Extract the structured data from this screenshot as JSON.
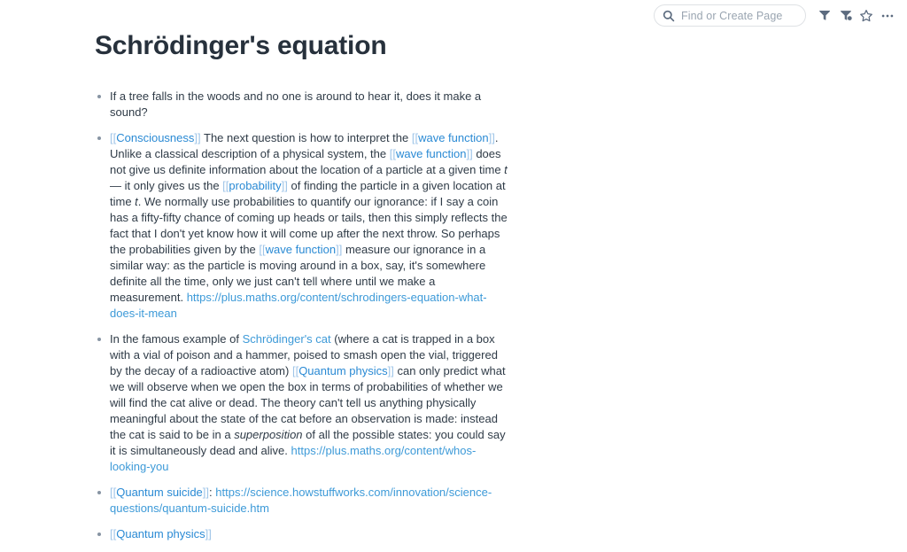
{
  "topbar": {
    "search": {
      "placeholder": "Find or Create Page",
      "value": "",
      "icon": "search-icon"
    },
    "icons": [
      {
        "name": "filter-icon",
        "label": "Filter"
      },
      {
        "name": "linked-references-icon",
        "label": "Linked References"
      },
      {
        "name": "star-icon",
        "label": "Favorite"
      },
      {
        "name": "more-options-icon",
        "label": "More"
      }
    ]
  },
  "page": {
    "title": "Schrödinger's equation",
    "bullets": [
      {
        "id": "bullet-tree-falls",
        "tokens": [
          {
            "t": "text",
            "v": "If a tree falls in the woods and no one is around to hear it, does it make a sound?"
          }
        ]
      },
      {
        "id": "bullet-consciousness",
        "tokens": [
          {
            "t": "brk",
            "v": "[["
          },
          {
            "t": "wikilink",
            "v": "Consciousness"
          },
          {
            "t": "brk",
            "v": "]]"
          },
          {
            "t": "text",
            "v": " The next question is how to interpret the "
          },
          {
            "t": "brk",
            "v": "[["
          },
          {
            "t": "wikilink",
            "v": "wave function"
          },
          {
            "t": "brk",
            "v": "]]"
          },
          {
            "t": "text",
            "v": ". Unlike a classical description of a physical system, the "
          },
          {
            "t": "brk",
            "v": "[["
          },
          {
            "t": "wikilink",
            "v": "wave function"
          },
          {
            "t": "brk",
            "v": "]]"
          },
          {
            "t": "text",
            "v": " does not give us definite information about the location of a particle at a given time "
          },
          {
            "t": "italic",
            "v": "t"
          },
          {
            "t": "text",
            "v": " — it only gives us the "
          },
          {
            "t": "brk",
            "v": "[["
          },
          {
            "t": "wikilink",
            "v": "probability"
          },
          {
            "t": "brk",
            "v": "]]"
          },
          {
            "t": "text",
            "v": " of finding the particle in a given location at time "
          },
          {
            "t": "italic",
            "v": "t"
          },
          {
            "t": "text",
            "v": ". We normally use probabilities to quantify our ignorance: if I say a coin has a fifty-fifty chance of coming up heads or tails, then this simply reflects the fact that I don't yet know how it will come up after the next throw. So perhaps the probabilities given by the "
          },
          {
            "t": "brk",
            "v": "[["
          },
          {
            "t": "wikilink",
            "v": "wave function"
          },
          {
            "t": "brk",
            "v": "]]"
          },
          {
            "t": "text",
            "v": " measure our ignorance in a similar way: as the particle is moving around in a box, say, it's somewhere definite all the time, only we just can't tell where until we make a measurement. "
          },
          {
            "t": "extlink",
            "v": "https://plus.maths.org/content/schrodingers-equation-what-does-it-mean"
          }
        ]
      },
      {
        "id": "bullet-schrodingers-cat",
        "tokens": [
          {
            "t": "text",
            "v": "In the famous example of "
          },
          {
            "t": "pagelink",
            "v": "Schrödinger's cat"
          },
          {
            "t": "text",
            "v": " (where a cat is trapped in a box with a vial of poison and a hammer, poised to smash open the vial, triggered by the decay of a radioactive atom) "
          },
          {
            "t": "brk",
            "v": "[["
          },
          {
            "t": "wikilink",
            "v": "Quantum physics"
          },
          {
            "t": "brk",
            "v": "]]"
          },
          {
            "t": "text",
            "v": " can only predict what we will observe when we open the box in terms of probabilities of whether we will find the cat alive or dead. The theory can't tell us anything physically meaningful about the state of the cat before an observation is made: instead the cat is said to be in a "
          },
          {
            "t": "italic",
            "v": "superposition"
          },
          {
            "t": "text",
            "v": " of all the possible states: you could say it is simultaneously dead and alive. "
          },
          {
            "t": "extlink",
            "v": "https://plus.maths.org/content/whos-looking-you"
          }
        ]
      },
      {
        "id": "bullet-quantum-suicide",
        "tokens": [
          {
            "t": "brk",
            "v": "[["
          },
          {
            "t": "wikilink",
            "v": "Quantum suicide"
          },
          {
            "t": "brk",
            "v": "]]"
          },
          {
            "t": "text",
            "v": ": "
          },
          {
            "t": "extlink",
            "v": "https://science.howstuffworks.com/innovation/science-questions/quantum-suicide.htm"
          }
        ]
      },
      {
        "id": "bullet-quantum-physics",
        "tokens": [
          {
            "t": "brk",
            "v": "[["
          },
          {
            "t": "wikilink",
            "v": "Quantum physics"
          },
          {
            "t": "brk",
            "v": "]]"
          }
        ]
      }
    ]
  },
  "colors": {
    "text": "#2f3b47",
    "title": "#27313c",
    "wikilink": "#2a8ad4",
    "bracket": "#9fc5e8",
    "external_link": "#3d9ad8",
    "bullet": "#8794a3",
    "placeholder": "#9aa5b1",
    "icon": "#5c6b7f",
    "border": "#dfe2e5",
    "background": "#ffffff"
  }
}
